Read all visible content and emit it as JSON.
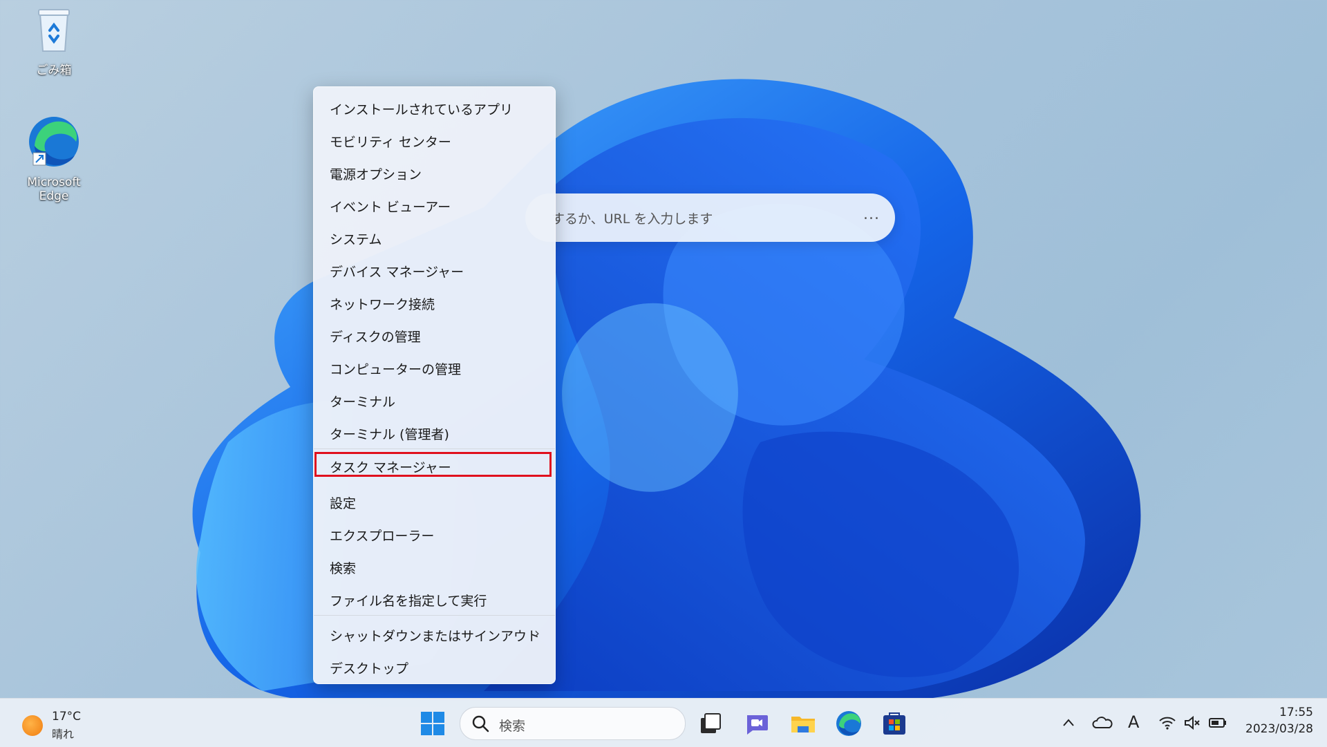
{
  "desktop": {
    "recycle_bin_label": "ごみ箱",
    "edge_label": "Microsoft Edge"
  },
  "browser": {
    "address_placeholder_fragment": "するか、URL を入力します",
    "more_button": "..."
  },
  "context_menu": {
    "items": [
      "インストールされているアプリ",
      "モビリティ センター",
      "電源オプション",
      "イベント ビューアー",
      "システム",
      "デバイス マネージャー",
      "ネットワーク接続",
      "ディスクの管理",
      "コンピューターの管理",
      "ターミナル",
      "ターミナル (管理者)",
      "タスク マネージャー",
      "設定",
      "エクスプローラー",
      "検索",
      "ファイル名を指定して実行",
      "シャットダウンまたはサインアウト",
      "デスクトップ"
    ],
    "highlighted": "タスク マネージャー",
    "submenu_chevron": "›"
  },
  "taskbar": {
    "weather_temp": "17°C",
    "weather_condition": "晴れ",
    "search_placeholder": "検索",
    "ime_indicator": "A",
    "clock_time": "17:55",
    "clock_date": "2023/03/28"
  },
  "colors": {
    "highlight_border": "#e0101e",
    "menu_bg": "#ecf1f9",
    "taskbar_bg": "#e8eef6"
  }
}
